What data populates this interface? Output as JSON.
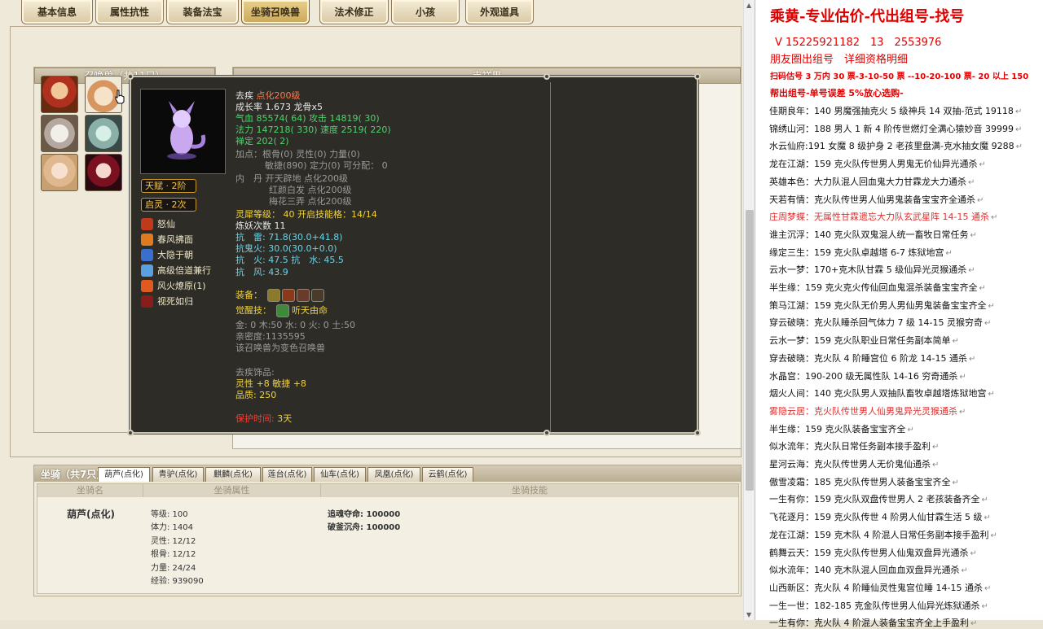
{
  "tabs": [
    {
      "label": "基本信息",
      "active": false
    },
    {
      "label": "属性抗性",
      "active": false
    },
    {
      "label": "装备法宝",
      "active": false
    },
    {
      "label": "坐骑召唤兽",
      "active": true
    },
    {
      "label": "法术修正",
      "active": false
    },
    {
      "label": "小孩",
      "active": false
    },
    {
      "label": "外观道具",
      "active": false
    }
  ],
  "summon_panel": {
    "title": "召唤兽（共11只）"
  },
  "right_panel": {
    "title": "吉祥果"
  },
  "tooltip": {
    "name": "去疾",
    "name_tag": "点化200级",
    "growth": "成长率 1.673 龙骨x5",
    "hp": "气血 85574( 64) 攻击 14819( 30)",
    "mp": "法力 147218( 330) 速度 2519( 220)",
    "zen": "禅定 202( 2)",
    "points1": "加点：根骨(0) 灵性(0) 力量(0)",
    "points2": "敏捷(890) 定力(0) 可分配： 0",
    "neidan1": "内　丹 开天辟地 点化200级",
    "neidan2": "红颜白发 点化200级",
    "neidan3": "梅花三弄 点化200级",
    "lingxi": "灵犀等级： 40 开启技能格：14/14",
    "lianyao": "炼妖次数 11",
    "res_thunder": "抗　雷: 71.8(30.0+41.8)",
    "res_ghost": "抗鬼火: 30.0(30.0+0.0)",
    "res_fire_water": "抗　火: 47.5 抗　水: 45.5",
    "res_wind": "抗　风: 43.9",
    "equip_label": "装备：",
    "awaken_label": "觉醒技：",
    "awaken_skill": "听天由命",
    "elements": "金: 0 木:50 水: 0 火: 0 土:50",
    "intimacy": "亲密度:1135595",
    "transform": "该召唤兽为变色召唤兽",
    "ornament_title": "去疾饰品:",
    "ornament_attr": "灵性 +8 敏捷 +8",
    "ornament_quality": "品质: 250",
    "protect_label": "保护时间:",
    "protect_value": "3天",
    "talent": "天赋 · 2阶",
    "qiling": "启灵 · 2次",
    "skills": [
      "怒仙",
      "春风拂面",
      "大隐于朝",
      "高级倍道兼行",
      "风火燎原(1)",
      "视死如归"
    ]
  },
  "mount": {
    "title": "坐骑（共7只）",
    "tabs": [
      "葫芦(点化)",
      "青驴(点化)",
      "麒麟(点化)",
      "莲台(点化)",
      "仙车(点化)",
      "凤凰(点化)",
      "云鹤(点化)"
    ],
    "headers": [
      "坐骑名",
      "坐骑属性",
      "坐骑技能"
    ],
    "name": "葫芦(点化)",
    "attrs": [
      "等级: 100",
      "体力: 1404",
      "灵性: 12/12",
      "根骨: 12/12",
      "力量: 24/24",
      "经验: 939090"
    ],
    "skills": [
      "追魂夺命: 100000",
      "破釜沉舟: 100000"
    ]
  },
  "notes": {
    "title": "乘黄-专业估价-代出组号-找号",
    "phone": "V 15225921182　13　2553976",
    "line2": "朋友圈出组号　详细资格明细",
    "line3": "扫码估号 3 万内 30 票-3-10-50 票 --10-20-100 票- 20 以上 150",
    "line4": "帮出组号-单号误差 5%放心选购-",
    "entries": [
      {
        "text": "佳期良年：140 男魔强抽克火 5 级神兵 14 双抽-范式 19118",
        "style": "normal"
      },
      {
        "text": "锦绣山河：188 男人 1 新 4 阶传世燃灯全满心猿妙音 39999",
        "style": "normal"
      },
      {
        "text": "水云仙府:191 女魔 8 级护身 2 老孩里盘满-克水抽女魔 9288",
        "style": "normal"
      },
      {
        "text": "龙在江湖：159 克火队传世男人男鬼无价仙异光通杀",
        "style": "normal"
      },
      {
        "text": "英雄本色：大力队混人回血鬼大力甘霖龙大力通杀",
        "style": "normal"
      },
      {
        "text": "天若有情：克火队传世男人仙男鬼装备宝宝齐全通杀",
        "style": "normal"
      },
      {
        "text": "庄周梦蝶：无属性甘霖遗忘大力队玄武星阵 14-15 通杀",
        "style": "red"
      },
      {
        "text": "谁主沉浮：140 克火队双鬼混人统一畜牧日常任务",
        "style": "normal"
      },
      {
        "text": "缘定三生：159 克火队卓越塔 6-7 炼狱地宫",
        "style": "normal"
      },
      {
        "text": "云水一梦：170+克木队甘霖 5 级仙异光灵猴通杀",
        "style": "normal"
      },
      {
        "text": "半生缘：159 克火克火传仙回血鬼混杀装备宝宝齐全",
        "style": "normal"
      },
      {
        "text": "策马江湖：159 克火队无价男人男仙男鬼装备宝宝齐全",
        "style": "normal"
      },
      {
        "text": "穿云破晓：克火队睡杀回气体力 7 级 14-15 灵猴穷奇",
        "style": "normal"
      },
      {
        "text": "云水一梦：159 克火队职业日常任务副本简单",
        "style": "normal"
      },
      {
        "text": "穿去破晓：克火队 4 阶睡宫位 6 阶龙 14-15 通杀",
        "style": "normal"
      },
      {
        "text": "水晶宫：190-200 级无属性队 14-16 穷奇通杀",
        "style": "normal"
      },
      {
        "text": "烟火人间：140 克火队男人双抽队畜牧卓越塔炼狱地宫",
        "style": "normal"
      },
      {
        "text": "雾隐云居：克火队传世男人仙男鬼异光灵猴通杀",
        "style": "red"
      },
      {
        "text": "半生缘：159 克火队装备宝宝齐全",
        "style": "normal"
      },
      {
        "text": "似水流年：克火队日常任务副本接手盈利",
        "style": "normal"
      },
      {
        "text": "星河云海：克火队传世男人无价鬼仙通杀",
        "style": "normal"
      },
      {
        "text": "傲雪凌霜：185 克火队传世男人装备宝宝齐全",
        "style": "normal"
      },
      {
        "text": "一生有你：159 克火队双盘传世男人 2 老孩装备齐全",
        "style": "normal"
      },
      {
        "text": "飞花逐月：159 克火队传世 4 阶男人仙甘霖生活 5 级",
        "style": "normal"
      },
      {
        "text": "龙在江湖：159 克木队 4 阶混人日常任务副本接手盈利",
        "style": "normal"
      },
      {
        "text": "鹤舞云天：159 克火队传世男人仙鬼双盘异光通杀",
        "style": "normal"
      },
      {
        "text": "似水流年：140 克木队混人回血血双盘异光通杀",
        "style": "normal"
      },
      {
        "text": "山西新区：克火队 4 阶睡仙灵性鬼宫位睡 14-15 通杀",
        "style": "normal"
      },
      {
        "text": "一生一世：182-185 克金队传世男人仙异光炼狱通杀",
        "style": "normal"
      },
      {
        "text": "一生有你：克火队 4 阶混人装备宝宝齐全上手盈利",
        "style": "normal"
      }
    ]
  }
}
